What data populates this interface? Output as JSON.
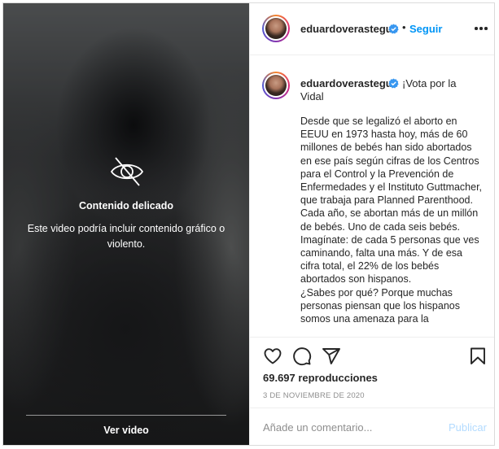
{
  "media": {
    "sensitive_title": "Contenido delicado",
    "sensitive_desc": "Este video podría incluir contenido gráfico o violento.",
    "see_video": "Ver video"
  },
  "header": {
    "username": "eduardoverastegui",
    "separator": "•",
    "follow": "Seguir"
  },
  "caption": {
    "username": "eduardoverastegui",
    "head_line1": "¡Vota por la",
    "head_line2": "Vidal",
    "body": "Desde que se legalizó el aborto en EEUU en 1973 hasta hoy, más de 60 millones de bebés han sido abortados en ese país según cifras de los Centros para el Control y la Prevención de Enfermedades y el Instituto Guttmacher, que trabaja para Planned Parenthood. Cada año, se abortan más de un millón de bebés. Uno de cada seis bebés. Imagínate: de cada 5 personas que ves caminando, falta una más. Y de esa cifra total, el 22% de los bebés abortados son hispanos.\n¿Sabes por qué? Porque muchas personas piensan que los hispanos somos una amenaza para la"
  },
  "actions": {
    "views": "69.697 reproducciones",
    "date": "3 DE NOVIEMBRE DE 2020"
  },
  "comment_box": {
    "placeholder": "Añade un comentario...",
    "publish": "Publicar"
  },
  "colors": {
    "link_blue": "#0095f6",
    "publish_disabled": "#b3dbff",
    "text": "#262626",
    "muted": "#8e8e8e"
  },
  "icons": [
    "eye-slash-icon",
    "verified-badge-icon",
    "more-options-icon",
    "heart-icon",
    "comment-icon",
    "share-icon",
    "bookmark-icon"
  ]
}
